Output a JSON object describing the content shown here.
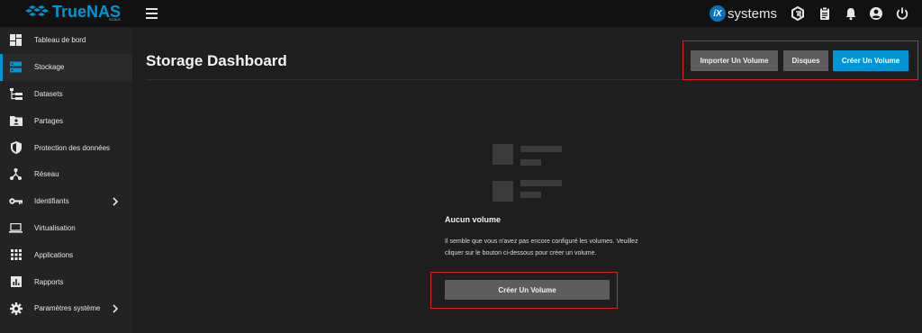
{
  "brand": {
    "name": "TrueNAS",
    "edition": "SCALE",
    "vendor_badge": "iX",
    "vendor_text": "systems",
    "accent": "#0095d5",
    "highlight": "#d62424"
  },
  "topbar": {
    "menu_icon": "hamburger-icon",
    "icons": [
      "truecommand-icon",
      "clipboard-icon",
      "bell-icon",
      "account-circle-icon",
      "power-icon"
    ]
  },
  "sidebar": {
    "items": [
      {
        "label": "Tableau de bord",
        "icon": "dashboard-icon"
      },
      {
        "label": "Stockage",
        "icon": "storage-icon",
        "active": true
      },
      {
        "label": "Datasets",
        "icon": "datasets-icon"
      },
      {
        "label": "Partages",
        "icon": "shares-icon"
      },
      {
        "label": "Protection des données",
        "icon": "shield-icon"
      },
      {
        "label": "Réseau",
        "icon": "network-icon"
      },
      {
        "label": "Identifiants",
        "icon": "key-icon",
        "expandable": true
      },
      {
        "label": "Virtualisation",
        "icon": "laptop-icon"
      },
      {
        "label": "Applications",
        "icon": "apps-grid-icon"
      },
      {
        "label": "Rapports",
        "icon": "chart-icon"
      },
      {
        "label": "Paramètres système",
        "icon": "gear-icon",
        "expandable": true
      }
    ]
  },
  "main": {
    "title": "Storage Dashboard",
    "actions": {
      "import_label": "Importer Un Volume",
      "disks_label": "Disques",
      "create_label": "Créer Un Volume"
    },
    "empty": {
      "title": "Aucun volume",
      "description": "Il semble que vous n'avez pas encore configuré les volumes. Veuillez cliquer sur le bouton ci-dessous pour créer un volume.",
      "button_label": "Créer Un Volume"
    }
  }
}
